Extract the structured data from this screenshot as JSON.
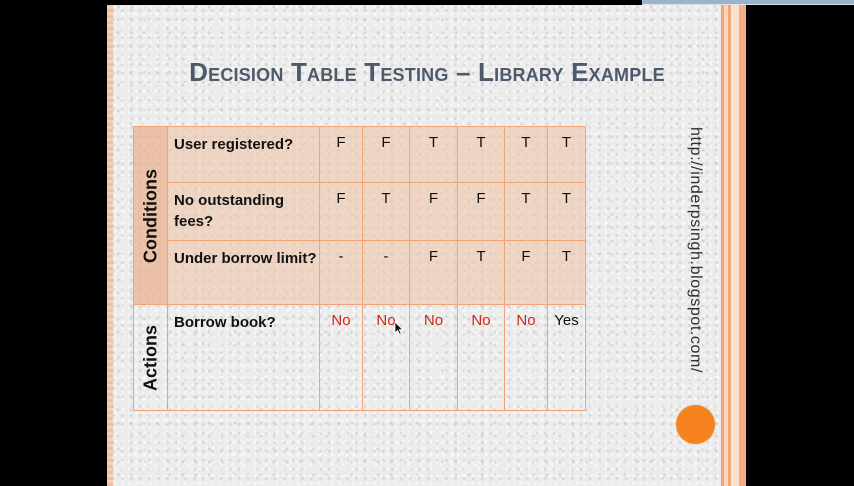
{
  "slide": {
    "title": "Decision Table Testing – Library Example",
    "url": "http://inderpsingh.blogspot.com/"
  },
  "table": {
    "groups": {
      "conditions": "Conditions",
      "actions": "Actions"
    },
    "rows": [
      {
        "label": "User registered?",
        "values": [
          "F",
          "F",
          "T",
          "T",
          "T",
          "T"
        ]
      },
      {
        "label": "No outstanding fees?",
        "values": [
          "F",
          "T",
          "F",
          "F",
          "T",
          "T"
        ]
      },
      {
        "label": "Under borrow limit?",
        "values": [
          "-",
          "-",
          "F",
          "T",
          "F",
          "T"
        ]
      },
      {
        "label": "Borrow  book?",
        "values": [
          "No",
          "No",
          "No",
          "No",
          "No",
          "Yes"
        ]
      }
    ]
  },
  "colors": {
    "title": "#4d5a6c",
    "condition_fill": "#f0c4a8",
    "grid": "#f0a477",
    "no_text": "#cc2a1a",
    "accent_dot": "#f5821f"
  },
  "icons": {
    "cursor": "mouse-pointer-icon",
    "dot": "orange-circle-decoration"
  }
}
